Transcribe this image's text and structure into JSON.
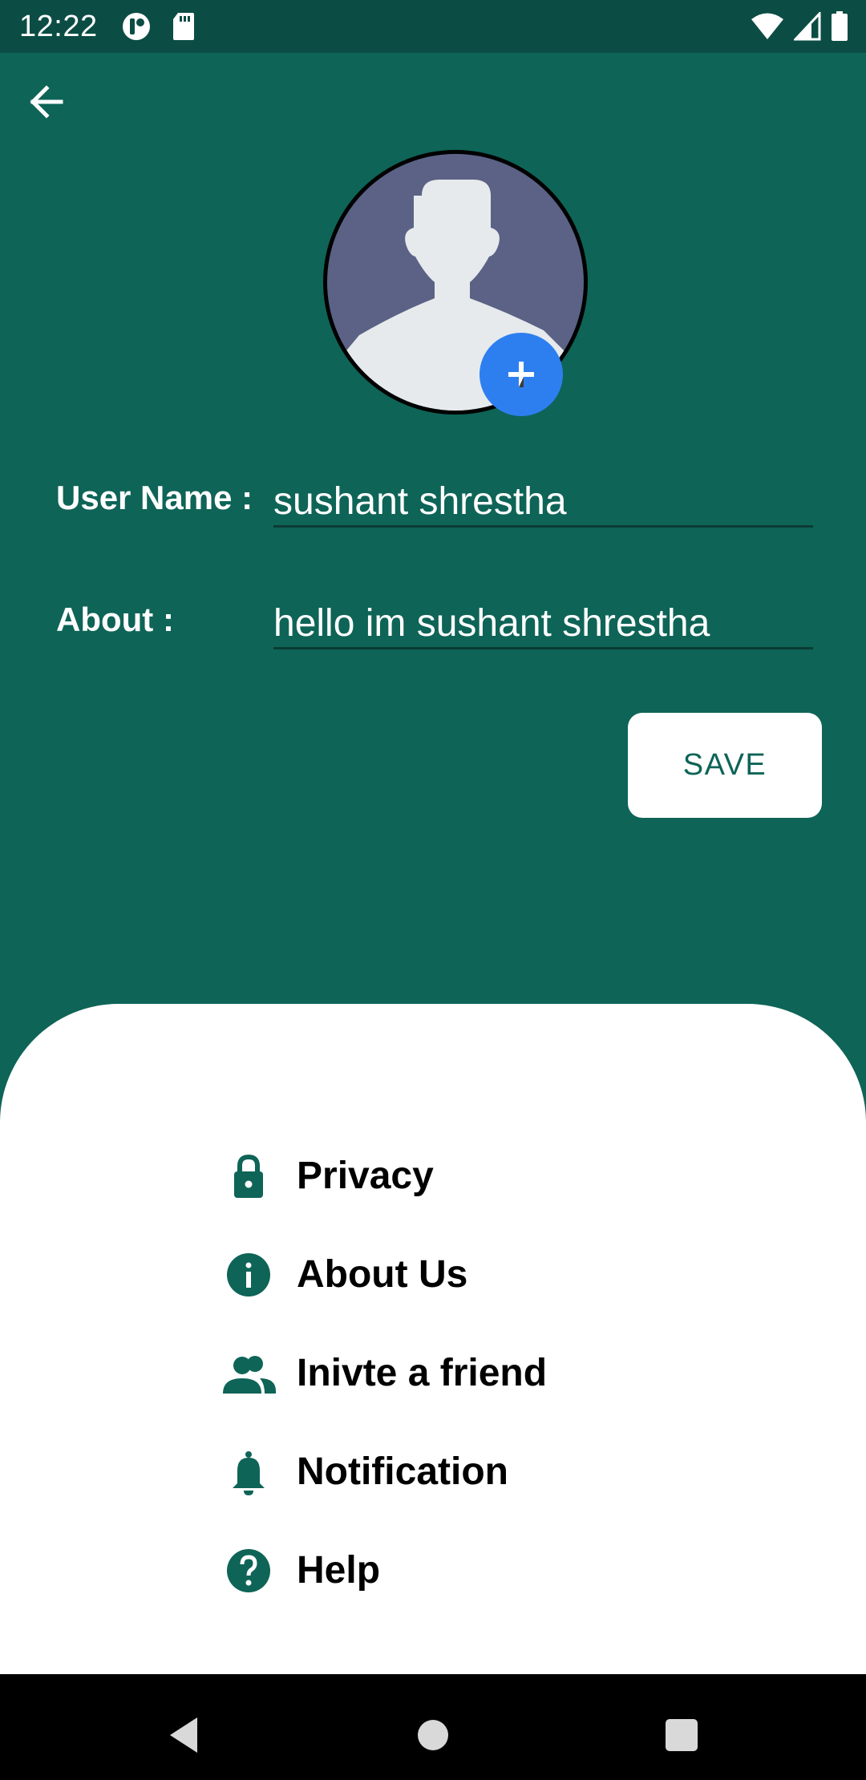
{
  "status_bar": {
    "time": "12:22",
    "left_icons": [
      "data-saver-icon",
      "sd-card-icon"
    ],
    "right_icons": [
      "wifi-icon",
      "signal-icon",
      "battery-icon"
    ]
  },
  "toolbar": {
    "back_icon": "arrow-left-icon"
  },
  "profile": {
    "avatar_icon": "default-user-avatar-icon",
    "add_photo_icon": "plus-icon"
  },
  "form": {
    "username_label": "User Name :",
    "username_value": "sushant shrestha",
    "about_label": "About :",
    "about_value": "hello im sushant shrestha",
    "save_label": "SAVE"
  },
  "menu": {
    "items": [
      {
        "label": "Privacy",
        "icon": "lock-icon"
      },
      {
        "label": "About Us",
        "icon": "info-icon"
      },
      {
        "label": "Inivte a friend",
        "icon": "people-icon"
      },
      {
        "label": "Notification",
        "icon": "bell-icon"
      },
      {
        "label": "Help",
        "icon": "help-icon"
      }
    ]
  },
  "colors": {
    "primary": "#0e6457",
    "status_bar": "#0b4d44",
    "accent_fab": "#2d7ff0",
    "avatar_bg": "#5b6286",
    "sheet": "#ffffff",
    "nav_bar": "#000000"
  },
  "nav_bar": {
    "icons": [
      "back-triangle-icon",
      "home-circle-icon",
      "recents-square-icon"
    ]
  }
}
